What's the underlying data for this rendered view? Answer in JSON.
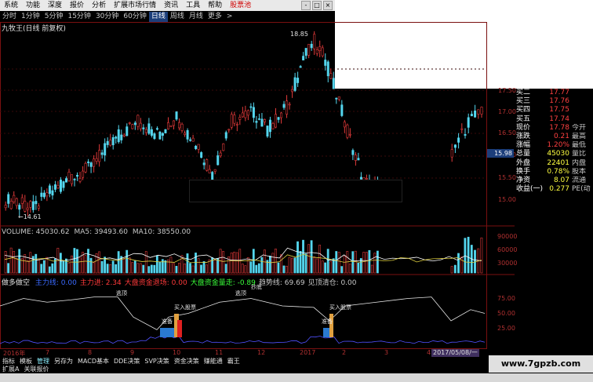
{
  "menu": {
    "items": [
      "系统",
      "功能",
      "深度",
      "报价",
      "分析",
      "扩展市场行情",
      "资讯",
      "工具",
      "帮助"
    ],
    "hot": "股票池",
    "window_buttons": [
      "-",
      "□",
      "×"
    ]
  },
  "periods": {
    "items": [
      "分时",
      "1分钟",
      "5分钟",
      "15分钟",
      "30分钟",
      "60分钟",
      "日线",
      "周线",
      "月线",
      "更多"
    ],
    "active_index": 6,
    "more_arrow": ">"
  },
  "chart": {
    "title": "九牧王(日线 前复权)",
    "high_label": "18.85",
    "low_label": "←14.61",
    "price_ticks": [
      "17.50",
      "17.00",
      "16.50",
      "16.00",
      "15.50",
      "15.00"
    ],
    "current_price": "15.98",
    "candle_colors": {
      "up": "#e23a3a",
      "down": "#54d6ee"
    }
  },
  "quote": {
    "rows": [
      {
        "label": "买二",
        "value": "17.77",
        "aux": ""
      },
      {
        "label": "买三",
        "value": "17.76",
        "aux": ""
      },
      {
        "label": "买四",
        "value": "17.75",
        "aux": ""
      },
      {
        "label": "买五",
        "value": "17.74",
        "aux": ""
      },
      {
        "label": "现价",
        "value": "17.78",
        "aux": "今开"
      },
      {
        "label": "涨跌",
        "value": "0.21",
        "aux": "最高"
      },
      {
        "label": "涨幅",
        "value": "1.20%",
        "aux": "最低"
      },
      {
        "label": "总量",
        "value": "45030",
        "aux": "量比"
      },
      {
        "label": "外盘",
        "value": "22401",
        "aux": "内盘"
      },
      {
        "label": "换手",
        "value": "0.78%",
        "aux": "股本"
      },
      {
        "label": "净资",
        "value": "8.07",
        "aux": "流通"
      },
      {
        "label": "收益(一)",
        "value": "0.277",
        "aux": "PE(动"
      }
    ]
  },
  "volume": {
    "label": "VOLUME:",
    "value": "45030.62",
    "ma5_label": "MA5:",
    "ma5": "39493.60",
    "ma10_label": "MA10:",
    "ma10": "38550.00",
    "ticks": [
      "90000",
      "60000",
      "30000"
    ]
  },
  "indicator": {
    "name": "做多做空",
    "legend": [
      {
        "text": "主力线: 0.00",
        "color": "#3a6aff"
      },
      {
        "text": "主力进: 2.34",
        "color": "#ff3a3a"
      },
      {
        "text": "大盘资金退场: 0.00",
        "color": "#ff3a3a"
      },
      {
        "text": "大盘资金量走: -0.89",
        "color": "#3aff3a"
      },
      {
        "text": "趋势线: 69.69",
        "color": "#c8c8c8"
      },
      {
        "text": "见顶清仓: 0.00",
        "color": "#c8c8c8"
      }
    ],
    "ticks": [
      "75.00",
      "50.00",
      "25.00"
    ],
    "annotations": [
      "逃顶",
      "逃顶",
      "买入股票",
      "准备",
      "买入股票",
      "准备",
      "抄底"
    ]
  },
  "dates": {
    "labels": [
      "2016年",
      "7",
      "8",
      "9",
      "10",
      "11",
      "12",
      "2017",
      "2",
      "3",
      "4"
    ],
    "current": "2017/05/08/一"
  },
  "tabs": {
    "row1": [
      "指标",
      "模板",
      "管理",
      "另存为",
      "MACD基本",
      "DDE决策",
      "SVP决策",
      "资金决策",
      "赚能通",
      "霸王"
    ],
    "row1_active": 2,
    "row2": [
      "扩展A",
      "关联报价"
    ]
  },
  "watermark": "www.7gpzb.com"
}
